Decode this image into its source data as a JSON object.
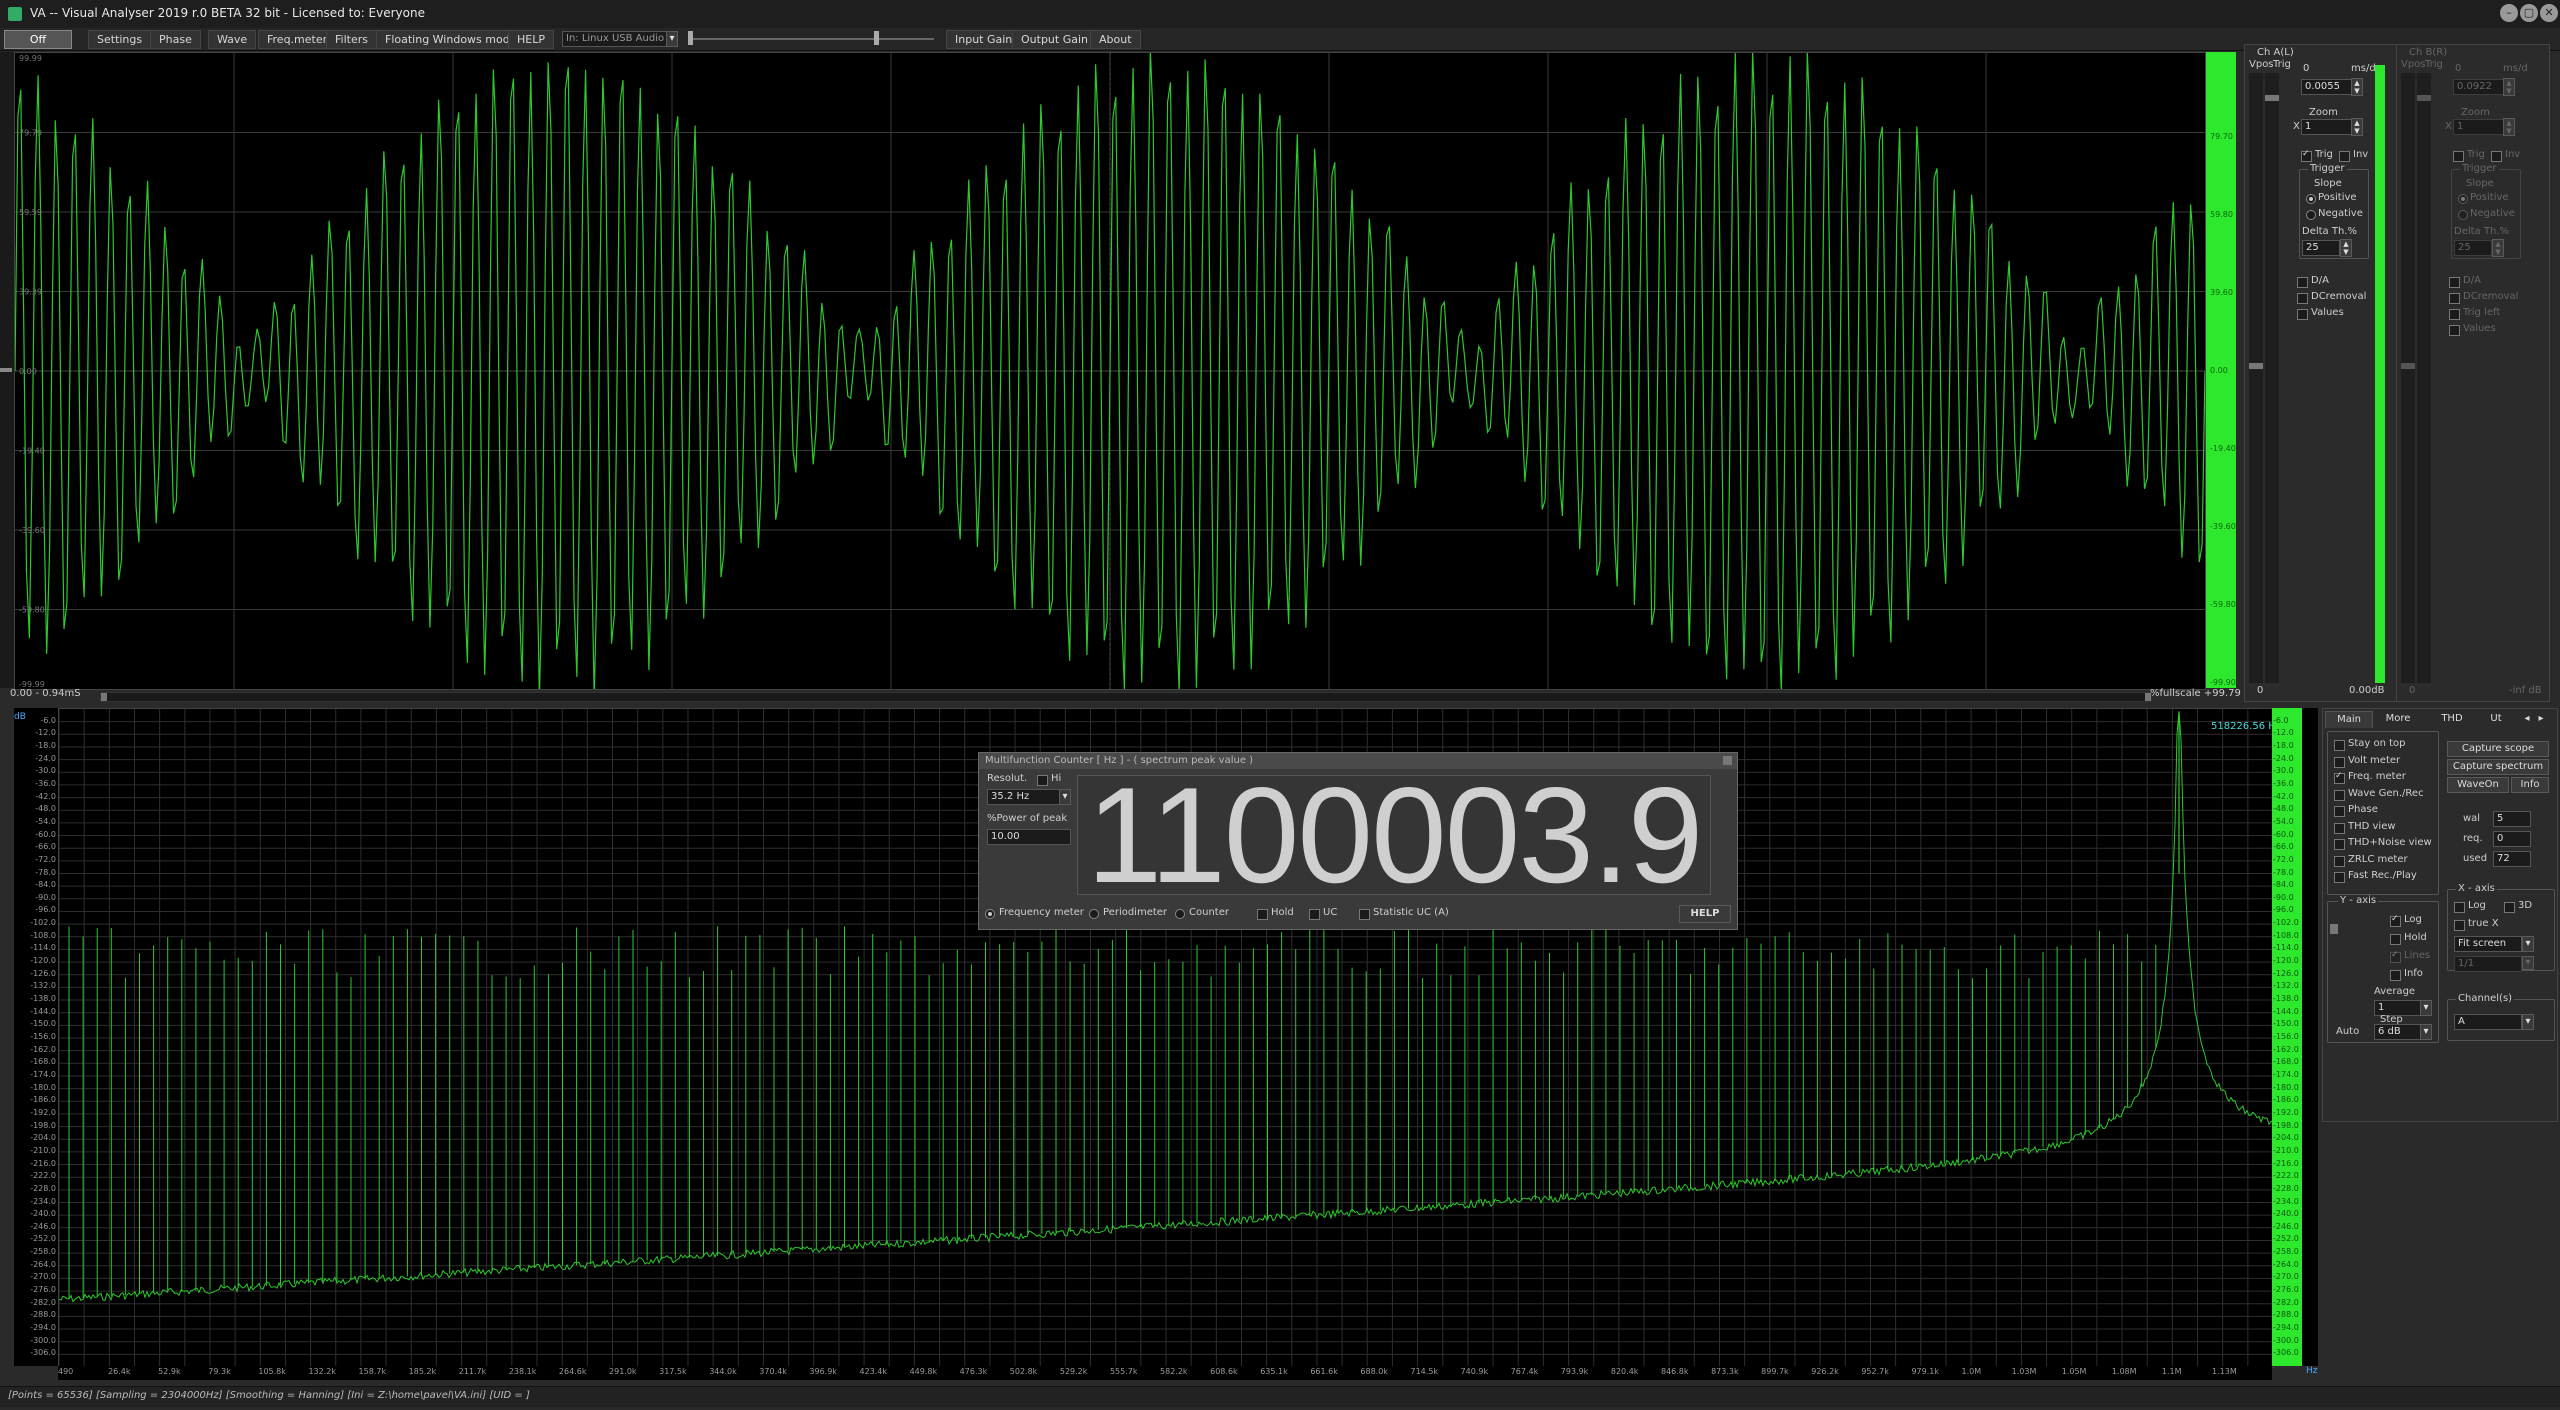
{
  "window": {
    "title": "VA -- Visual Analyser 2019 r.0 BETA 32 bit - Licensed to: Everyone",
    "min_icon": "minimize-icon",
    "max_icon": "maximize-icon",
    "close_icon": "close-icon"
  },
  "toolbar": {
    "items": [
      "Off",
      "Settings",
      "Phase",
      "Wave",
      "Freq.meter",
      "Filters",
      "Floating Windows mode",
      "HELP"
    ],
    "input_device": "In: Linux USB Audio",
    "input_gain": "Input Gain",
    "output_gain": "Output Gain",
    "about": "About"
  },
  "scope": {
    "y_ticks": [
      "99.99",
      "79.79",
      "59.59",
      "39.39",
      "0.00",
      "-19.40",
      "-39.60",
      "-59.80",
      "-99.99"
    ],
    "right_ticks": [
      "79.70",
      "59.80",
      "39.60",
      "0.00",
      "-19.40",
      "-39.60",
      "-59.80",
      "-99.90"
    ],
    "time_readout": "0.00 - 0.94mS",
    "fullscale": "%fullscale +99.79"
  },
  "chA": {
    "title": "Ch A(L)",
    "vpos": "Vpos",
    "trig": "Trig",
    "msd_value": "0.0055",
    "msd_unit": "ms/d",
    "msd_top": "0",
    "zoom_label": "Zoom",
    "zoom_value": "1",
    "zoom_x": "X",
    "trig_label": "Trig",
    "inv_label": "Inv",
    "trigger_label": "Trigger",
    "slope_label": "Slope",
    "positive": "Positive",
    "negative": "Negative",
    "delta_label": "Delta Th.%",
    "delta_value": "25",
    "da": "D/A",
    "dcremoval": "DCremoval",
    "values": "Values",
    "level_min": "0",
    "level_db": "0.00dB"
  },
  "chB": {
    "title": "Ch B(R)",
    "vpos": "Vpos",
    "trig": "Trig",
    "msd_value": "0.0922",
    "msd_unit": "ms/d",
    "msd_top": "0",
    "zoom_label": "Zoom",
    "zoom_value": "1",
    "zoom_x": "X",
    "trig_label": "Trig",
    "inv_label": "Inv",
    "trigger_label": "Trigger",
    "slope_label": "Slope",
    "positive": "Positive",
    "negative": "Negative",
    "delta_label": "Delta Th.%",
    "delta_value": "25",
    "da": "D/A",
    "dcremoval": "DCremoval",
    "trig_left": "Trig left",
    "values": "Values",
    "level_min": "0",
    "level_db": "-inf dB"
  },
  "spectrum": {
    "peak_readout": "518226.56 Hz",
    "y_unit": "dB",
    "y_ticks": [
      "-6.0",
      "-12.0",
      "-18.0",
      "-24.0",
      "-30.0",
      "-36.0",
      "-42.0",
      "-48.0",
      "-54.0",
      "-60.0",
      "-66.0",
      "-72.0",
      "-78.0",
      "-84.0",
      "-90.0",
      "-96.0",
      "-102.0",
      "-108.0",
      "-114.0",
      "-120.0",
      "-126.0",
      "-132.0",
      "-138.0",
      "-144.0",
      "-150.0",
      "-156.0",
      "-162.0",
      "-168.0",
      "-174.0",
      "-180.0",
      "-186.0",
      "-192.0",
      "-198.0",
      "-204.0",
      "-210.0",
      "-216.0",
      "-222.0",
      "-228.0",
      "-234.0",
      "-240.0",
      "-246.0",
      "-252.0",
      "-258.0",
      "-264.0",
      "-270.0",
      "-276.0",
      "-282.0",
      "-288.0",
      "-294.0",
      "-300.0",
      "-306.0"
    ],
    "x_ticks": [
      "490",
      "26.4k",
      "52.9k",
      "79.3k",
      "105.8k",
      "132.2k",
      "158.7k",
      "185.2k",
      "211.7k",
      "238.1k",
      "264.6k",
      "291.0k",
      "317.5k",
      "344.0k",
      "370.4k",
      "396.9k",
      "423.4k",
      "449.8k",
      "476.3k",
      "502.8k",
      "529.2k",
      "555.7k",
      "582.2k",
      "608.6k",
      "635.1k",
      "661.6k",
      "688.0k",
      "714.5k",
      "740.9k",
      "767.4k",
      "793.9k",
      "820.4k",
      "846.8k",
      "873.3k",
      "899.7k",
      "926.2k",
      "952.7k",
      "979.1k",
      "1.0M",
      "1.03M",
      "1.05M",
      "1.08M",
      "1.1M",
      "1.13M"
    ],
    "x_unit": "Hz"
  },
  "counter": {
    "title": "Multifunction Counter [ Hz ] - ( spectrum peak value )",
    "resolut_label": "Resolut.",
    "hi_label": "Hi",
    "resolution_value": "35.2 Hz",
    "power_label": "%Power of peak",
    "power_value": "10.00",
    "reading": "1100003.9",
    "modes": [
      "Frequency meter",
      "Periodimeter",
      "Counter"
    ],
    "hold": "Hold",
    "uc": "UC",
    "statistic": "Statistic UC (A)",
    "help": "HELP"
  },
  "control": {
    "tabs": [
      "Main",
      "More",
      "THD",
      "Ut"
    ],
    "checks": [
      {
        "label": "Stay on top",
        "on": false
      },
      {
        "label": "Volt meter",
        "on": false
      },
      {
        "label": "Freq. meter",
        "on": true
      },
      {
        "label": "Wave Gen./Rec",
        "on": false
      },
      {
        "label": "Phase",
        "on": false
      },
      {
        "label": "THD view",
        "on": false
      },
      {
        "label": "THD+Noise view",
        "on": false
      },
      {
        "label": "ZRLC meter",
        "on": false
      },
      {
        "label": "Fast Rec./Play",
        "on": false
      }
    ],
    "capture_scope": "Capture scope",
    "capture_spectrum": "Capture spectrum",
    "waveon": "WaveOn",
    "info_btn": "Info",
    "wal_label": "wal",
    "wal_value": "5",
    "req_label": "req.",
    "req_value": "0",
    "used_label": "used",
    "used_value": "72",
    "yaxis": "Y - axis",
    "y_log": "Log",
    "y_hold": "Hold",
    "y_lines": "Lines",
    "y_info": "Info",
    "average_label": "Average",
    "average_value": "1",
    "step_label": "Step",
    "step_value": "6 dB",
    "auto": "Auto",
    "xaxis": "X - axis",
    "x_log": "Log",
    "x_3d": "3D",
    "x_truex": "true X",
    "fit": "Fit screen",
    "ratio": "1/1",
    "channels": "Channel(s)",
    "channel_value": "A"
  },
  "status": "[Points = 65536]  [Sampling = 2304000Hz]  [Smoothing = Hanning]  [Ini = Z:\\home\\pavel\\VA.ini]  [UID = ]"
}
